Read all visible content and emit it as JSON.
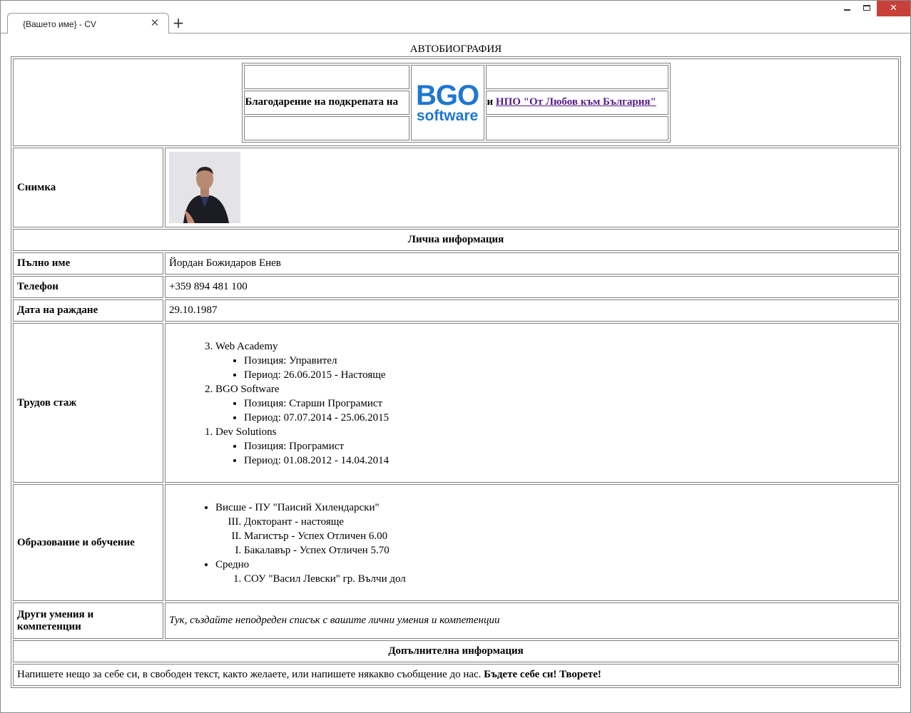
{
  "browser": {
    "tab_title": "{Вашето име} - CV",
    "close_tab_glyph": "✕",
    "new_tab_glyph": "+",
    "close_window_glyph": "✕",
    "close_button_color": "#c7413a"
  },
  "page": {
    "heading": "АВТОБИОГРАФИЯ",
    "thanks": {
      "text_before": "Благодарение на подкрепата на",
      "logo_top": "BGO",
      "logo_bottom": "software",
      "text_and": "и",
      "link_text": "НПО \"От Любов към България\"",
      "logo_color": "#1f77d0"
    },
    "photo_label": "Снимка",
    "personal_header": "Лична информация",
    "personal": {
      "name_label": "Пълно име",
      "name_value": "Йордан Божидаров Енев",
      "phone_label": "Телефон",
      "phone_value": "+359 894 481 100",
      "birth_label": "Дата на раждане",
      "birth_value": "29.10.1987"
    },
    "experience": {
      "label": "Трудов стаж",
      "jobs": [
        {
          "number": 3,
          "company": "Web Academy",
          "position": "Позиция: Управител",
          "period": "Период: 26.06.2015 - Настояще"
        },
        {
          "number": 2,
          "company": "BGO Software",
          "position": "Позиция: Старши Програмист",
          "period": "Период: 07.07.2014 - 25.06.2015"
        },
        {
          "number": 1,
          "company": "Dev Solutions",
          "position": "Позиция: Програмист",
          "period": "Период: 01.08.2012 - 14.04.2014"
        }
      ]
    },
    "education": {
      "label": "Образование и обучение",
      "higher": "Висше - ПУ \"Паисий Хилендарски\"",
      "higher_items": [
        {
          "number": 3,
          "text": "Докторант - настояще"
        },
        {
          "number": 2,
          "text": "Магистър - Успех Отличен 6.00"
        },
        {
          "number": 1,
          "text": "Бакалавър - Успех Отличен 5.70"
        }
      ],
      "secondary": "Средно",
      "secondary_items": [
        {
          "number": 1,
          "text": "СОУ \"Васил Левски\" гр. Вълчи дол"
        }
      ]
    },
    "skills": {
      "label": "Други умения и компетенции",
      "text": "Тук, създайте неподреден списък с вашите лични умения и компетенции"
    },
    "additional_header": "Допълнителна информация",
    "additional": {
      "text": "Напишете нещо за себе си, в свободен текст, както желаете, или напишете някакво съобщение до нас. ",
      "bold_text": "Бъдете себе си! Творете!"
    }
  }
}
